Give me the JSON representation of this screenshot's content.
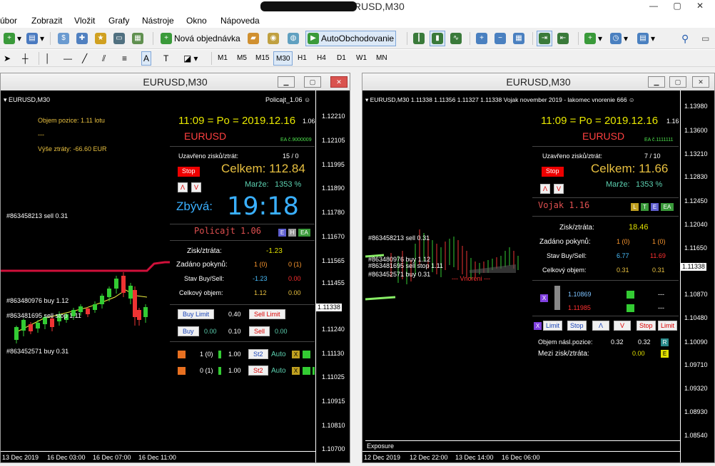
{
  "window": {
    "title": "Real - EURUSD,M30"
  },
  "menu": [
    "úbor",
    "Zobrazit",
    "Vložit",
    "Grafy",
    "Nástroje",
    "Okno",
    "Nápoveda"
  ],
  "toolbar": {
    "new_order": "Nová objednávka",
    "autotrading": "AutoObchodovanie"
  },
  "timeframes": [
    "M1",
    "M5",
    "M15",
    "M30",
    "H1",
    "H4",
    "D1",
    "W1",
    "MN"
  ],
  "left": {
    "title": "EURUSD,M30",
    "symbol": "EURUSD,M30",
    "ea_name": "Policajt_1.06",
    "objem": "Objem pozice: 1.11 lotu",
    "dash": "---",
    "vyse": "Výše ztráty: -66.60 EUR",
    "time": "11:09 = Po = 2019.12.16",
    "time_suffix": "1.06",
    "symbol_big": "EURUSD",
    "ea_code": "EA č.9000009",
    "uzavreno_label": "Uzavřeno zisků/ztrát:",
    "uzavreno_val": "15 / 0",
    "stop": "Stop",
    "celkem": "Celkem: 112.84",
    "marze_label": "Marže:",
    "marze_val": "1353 %",
    "lam": "Λ",
    "v": "V",
    "zbyva": "Zbývá:",
    "clock": "19:18",
    "ea_title": "Policajt 1.06",
    "tag_e": "E",
    "tag_h": "H",
    "tag_ea": "EA",
    "zisk_label": "Zisk/ztráta:",
    "zisk_val": "-1.23",
    "zadano_label": "Zadáno pokynů:",
    "zadano_a": "1 (0)",
    "zadano_b": "0 (1)",
    "stav_label": "Stav Buy/Sell:",
    "stav_a": "-1.23",
    "stav_b": "0.00",
    "celk_obj_label": "Celkový objem:",
    "celk_obj_a": "1.12",
    "celk_obj_b": "0.00",
    "buy_limit": "Buy Limit",
    "bl_val": "0.40",
    "sell_limit": "Sell Limit",
    "buy": "Buy",
    "buy_a": "0.00",
    "buy_b": "0.10",
    "sell": "Sell",
    "sell_b": "0.00",
    "r1_a": "1 (0)",
    "r1_b": "1.00",
    "r2_a": "0 (1)",
    "r2_b": "1.00",
    "st2": "St2",
    "auto": "Auto",
    "x": "X",
    "ord1": "#863458213 sell 0.31",
    "ord2": "#863480976 buy 1.12",
    "ord3": "#863481695 sell stop 1.11",
    "ord4": "#863452571 buy 0.31",
    "prices": [
      "1.12210",
      "1.12105",
      "1.11995",
      "1.11890",
      "1.11780",
      "1.11670",
      "1.11565",
      "1.11455",
      "1.11338",
      "1.11240",
      "1.11130",
      "1.11025",
      "1.10915",
      "1.10810",
      "1.10700"
    ],
    "current": "1.11338",
    "dates": [
      "13 Dec 2019",
      "16 Dec 03:00",
      "16 Dec 07:00",
      "16 Dec 11:00"
    ]
  },
  "right": {
    "title": "EURUSD,M30",
    "header": "EURUSD,M30  1.11338 1.11356 1.11327 1.11338  Vojak november 2019  - lakomec vnorenie 666",
    "time": "11:09 = Po = 2019.12.16",
    "time_suffix": "1.16",
    "symbol_big": "EURUSD",
    "ea_code": "EA č.1111111",
    "uzavreno_label": "Uzavřeno zisků/ztrát:",
    "uzavreno_val": "7 / 10",
    "stop": "Stop",
    "celkem": "Celkem: 11.66",
    "marze_label": "Marže:",
    "marze_val": "1353 %",
    "lam": "Λ",
    "v": "V",
    "ea_title": "Vojak 1.16",
    "tag_l": "L",
    "tag_t": "T",
    "tag_e": "E",
    "tag_ea": "EA",
    "zisk_label": "Zisk/ztráta:",
    "zisk_val": "18.46",
    "zadano_label": "Zadáno pokynů:",
    "zadano_a": "1 (0)",
    "zadano_b": "1 (0)",
    "stav_label": "Stav Buy/Sell:",
    "stav_a": "6.77",
    "stav_b": "11.69",
    "celk_obj_label": "Celkový objem:",
    "celk_obj_a": "0.31",
    "celk_obj_b": "0.31",
    "lvl1": "1.10869",
    "lvl2": "1.11985",
    "dashes": "---",
    "x": "X",
    "btns": [
      "X",
      "Limit",
      "Stop",
      "Λ",
      "V",
      "Stop",
      "Limit"
    ],
    "objem_label": "Objem násl.pozice:",
    "objem_a": "0.32",
    "objem_b": "0.32",
    "r": "R",
    "mezi_label": "Mezi zisk/ztráta:",
    "mezi_val": "0.00",
    "e": "E",
    "ord1": "#863458213 sell 0.31",
    "ord2": "#863480976 buy 1.12",
    "ord3": "#863481695 sell stop 1.11",
    "ord4": "#863452571 buy 0.31",
    "vnorenie": "--- Vnoreni ---",
    "prices": [
      "1.13980",
      "1.13600",
      "1.13210",
      "1.12830",
      "1.12450",
      "1.12040",
      "1.11650",
      "1.11338",
      "1.10870",
      "1.10480",
      "1.10090",
      "1.09710",
      "1.09320",
      "1.08930",
      "1.08540"
    ],
    "current": "1.11338",
    "dates": [
      "12 Dec 2019",
      "12 Dec 22:00",
      "13 Dec 14:00",
      "16 Dec 06:00"
    ],
    "exposure": "Exposure"
  },
  "colors": {
    "accent": "#3ab0ff",
    "loss": "#ff3030",
    "gain": "#e8c040"
  }
}
